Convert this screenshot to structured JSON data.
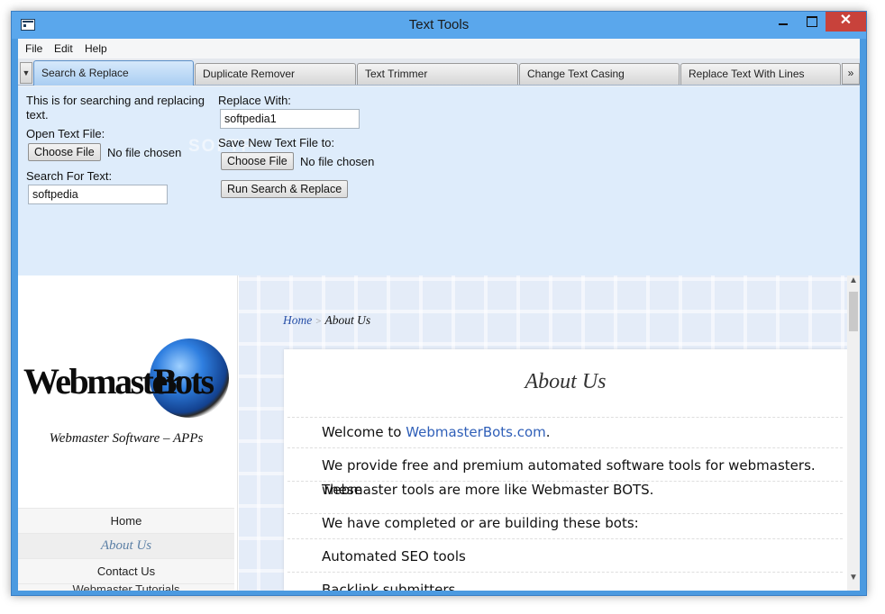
{
  "window": {
    "title": "Text Tools",
    "close_glyph": "✕"
  },
  "menu": {
    "items": [
      "File",
      "Edit",
      "Help"
    ]
  },
  "tabs": {
    "nav_glyph": "▼",
    "more_glyph": "»",
    "items": [
      {
        "label": "Search & Replace",
        "active": true
      },
      {
        "label": "Duplicate Remover",
        "active": false
      },
      {
        "label": "Text Trimmer",
        "active": false
      },
      {
        "label": "Change Text Casing",
        "active": false
      },
      {
        "label": "Replace Text With Lines",
        "active": false
      }
    ]
  },
  "search_replace": {
    "description_line1": "This is for searching and replacing",
    "description_line2": "text.",
    "open_file_label": "Open Text File:",
    "choose_file_label": "Choose File",
    "no_file_text": "No file chosen",
    "search_label": "Search For Text:",
    "search_value": "softpedia",
    "replace_label": "Replace With:",
    "replace_value": "softpedia1",
    "save_label": "Save New Text File to:",
    "save_choose_file_label": "Choose File",
    "save_no_file_text": "No file chosen",
    "run_button_label": "Run Search & Replace"
  },
  "site": {
    "logo_word1": "Webmaster",
    "logo_word2": "Bots",
    "tagline": "Webmaster Software – APPs",
    "nav": [
      {
        "label": "Home",
        "current": false
      },
      {
        "label": "About Us",
        "current": true
      },
      {
        "label": "Contact Us",
        "current": false
      },
      {
        "label": "Webmaster Tutorials",
        "current": false
      }
    ],
    "breadcrumb": {
      "home": "Home",
      "separator": ">",
      "current": "About Us"
    },
    "page_title": "About Us",
    "welcome_prefix": "Welcome to ",
    "welcome_link": "WebmasterBots.com",
    "welcome_suffix": ".",
    "para1_line1": "We provide free and premium automated software tools for webmasters. These",
    "para1_line2": "webmaster tools are more like Webmaster BOTS.",
    "para2": "We have completed or are building these bots:",
    "para3": "Automated SEO tools",
    "para4": "Backlink submitters"
  },
  "colors": {
    "titlebar": "#5aa7ec",
    "panel": "#deecfb",
    "link": "#2f5fb8"
  }
}
